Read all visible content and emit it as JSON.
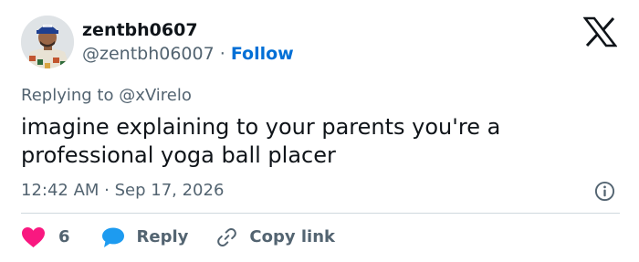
{
  "author": {
    "display_name": "zentbh0607",
    "handle": "@zentbh06007",
    "separator": "·",
    "follow_label": "Follow"
  },
  "reply_context": {
    "prefix": "Replying to",
    "target": "@xVirelo"
  },
  "tweet": {
    "text": "imagine explaining to your parents you're a professional yoga ball placer",
    "timestamp": "12:42 AM · Sep 17, 2026"
  },
  "actions": {
    "like_count": "6",
    "reply_label": "Reply",
    "copy_link_label": "Copy link"
  },
  "icons": {
    "brand": "x-logo-icon",
    "info": "info-icon",
    "like": "heart-icon",
    "reply": "speech-bubble-icon",
    "copy_link": "link-icon"
  },
  "colors": {
    "like": "#f91880",
    "reply": "#1d9bf0",
    "follow": "#006fd6",
    "muted_text": "#536471",
    "primary_text": "#0f1419",
    "divider": "#cfd9de"
  }
}
